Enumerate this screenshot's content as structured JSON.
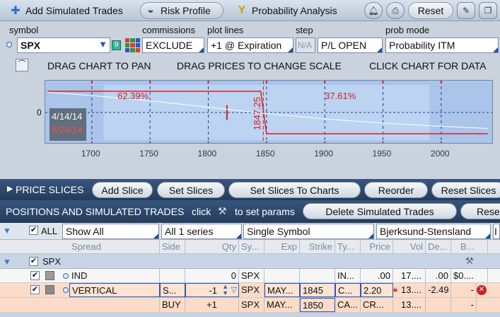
{
  "tabs": [
    {
      "label": "Add Simulated Trades",
      "icon": "plus-icon"
    },
    {
      "label": "Risk Profile",
      "icon": "risk-profile-icon"
    },
    {
      "label": "Probability Analysis",
      "icon": "probability-icon"
    }
  ],
  "toolbar": {
    "reset": "Reset"
  },
  "controls": {
    "symbol_label": "symbol",
    "symbol_value": "SPX",
    "symbol_badge": "9",
    "commissions_label": "commissions",
    "commissions_value": "EXCLUDE",
    "plot_lines_label": "plot lines",
    "plot_lines_value": "+1 @ Expiration",
    "step_label": "step",
    "step_value": "N/A",
    "step_mode_value": "P/L OPEN",
    "prob_mode_label": "prob mode",
    "prob_mode_value": "Probability ITM"
  },
  "hints": {
    "pan": "DRAG CHART TO PAN",
    "scale": "DRAG PRICES TO CHANGE SCALE",
    "data": "CLICK CHART FOR DATA"
  },
  "chart_data": {
    "type": "line",
    "xlabel": "",
    "ylabel": "",
    "x_ticks": [
      1700,
      1750,
      1800,
      1850,
      1900,
      1950,
      2000
    ],
    "y_ticks": [
      0
    ],
    "xlim": [
      1660,
      2045
    ],
    "prob_left": "62.39%",
    "prob_right": "37.61%",
    "marker_label": "1847.25",
    "date_start": "4/14/14",
    "date_end": "5/24/14",
    "series": [
      {
        "color": "#e02020",
        "x": [
          1662,
          1845,
          1850,
          2040
        ],
        "values": [
          1,
          1,
          -1,
          -1
        ]
      },
      {
        "color": "#ffffff",
        "x": [
          1662,
          1700,
          1750,
          1800,
          1850,
          1900,
          1950,
          2000,
          2040
        ],
        "values": [
          0.95,
          0.8,
          0.55,
          0.25,
          -0.05,
          -0.3,
          -0.5,
          -0.65,
          -0.75
        ]
      }
    ],
    "accent": "#1e4ca8",
    "background": "#aac4ea"
  },
  "price_slices": {
    "title": "PRICE SLICES",
    "buttons": [
      "Add Slice",
      "Set Slices",
      "Set Slices To Charts",
      "Reorder",
      "Reset Slices"
    ]
  },
  "positions": {
    "title": "POSITIONS AND SIMULATED TRADES",
    "hint_click": "click",
    "hint_params": "to set params",
    "delete_button": "Delete Simulated Trades",
    "reset_button": "Rese",
    "filter_all": "ALL",
    "filter_show": "Show All",
    "filter_series": "All 1 series",
    "filter_symbol": "Single Symbol",
    "filter_model": "Bjerksund-Stensland",
    "filter_extra": "I",
    "headers": [
      "Spread",
      "Side",
      "Qty",
      "Sy...",
      "Exp",
      "Strike",
      "Ty...",
      "Price",
      "Vol",
      "De...",
      "B..."
    ],
    "group": "SPX",
    "rows": [
      {
        "spread": "IND",
        "side": "",
        "qty": "0",
        "sym": "SPX",
        "exp": "",
        "strike": "",
        "type": "IN...",
        "price": ".00",
        "vol": "17....",
        "delta": ".00",
        "b": "$0...."
      },
      {
        "spread": "VERTICAL",
        "side": "S...",
        "qty": "-1",
        "sym": "SPX",
        "exp": "MAY...",
        "strike": "1845",
        "type": "C...",
        "price": "2.20",
        "vol": "13....",
        "delta": "-2.49",
        "b": "-"
      },
      {
        "spread": "",
        "side": "BUY",
        "qty": "+1",
        "sym": "SPX",
        "exp": "MAY...",
        "strike": "1850",
        "type": "CA...",
        "price": "CR...",
        "vol": "13....",
        "delta": "",
        "b": "-"
      }
    ]
  }
}
